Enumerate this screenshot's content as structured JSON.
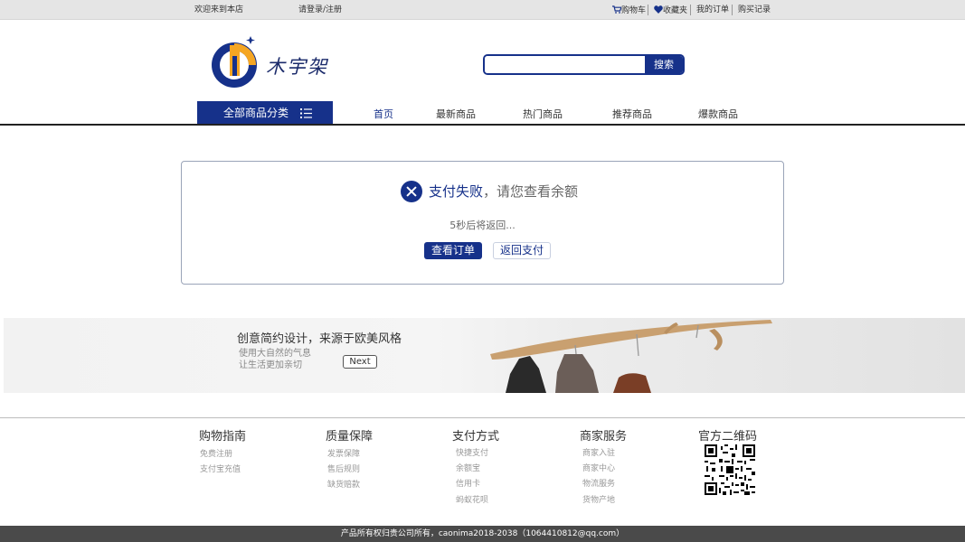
{
  "topbar": {
    "welcome": "欢迎来到本店",
    "login": "请登录/注册",
    "cart": "购物车",
    "favorites": "收藏夹",
    "orders": "我的订单",
    "history": "购买记录"
  },
  "header": {
    "logo_text": "木宇架",
    "search_placeholder": "",
    "search_button": "搜索"
  },
  "nav": {
    "all_categories": "全部商品分类",
    "items": [
      "首页",
      "最新商品",
      "热门商品",
      "推荐商品",
      "爆款商品"
    ]
  },
  "result": {
    "title": "支付失败",
    "subtitle": "，请您查看余额",
    "countdown": "5秒后将返回...",
    "view_order": "查看订单",
    "back_to_pay": "返回支付"
  },
  "banner": {
    "title": "创意简约设计，来源于欧美风格",
    "line1": "使用大自然的气息",
    "line2": "让生活更加亲切",
    "next": "Next"
  },
  "footer": {
    "columns": [
      {
        "title": "购物指南",
        "links": [
          "免费注册",
          "支付宝充值"
        ]
      },
      {
        "title": "质量保障",
        "links": [
          "发票保障",
          "售后规则",
          "缺货赔款"
        ]
      },
      {
        "title": "支付方式",
        "links": [
          "快捷支付",
          "余额宝",
          "信用卡",
          "蚂蚁花呗"
        ]
      },
      {
        "title": "商家服务",
        "links": [
          "商家入驻",
          "商家中心",
          "物流服务",
          "货物产地"
        ]
      },
      {
        "title": "官方二维码",
        "links": []
      }
    ],
    "copyright": "产品所有权归贵公司所有，caonima2018-2038（1064410812@qq.com）"
  },
  "colors": {
    "brand": "#16318a",
    "logo_yellow": "#f5a623",
    "footer_bar": "#4a4a4a"
  },
  "icons": {
    "cart": "cart-icon",
    "favorites": "heart-icon",
    "categories": "list-icon",
    "error": "close-circle-icon"
  }
}
